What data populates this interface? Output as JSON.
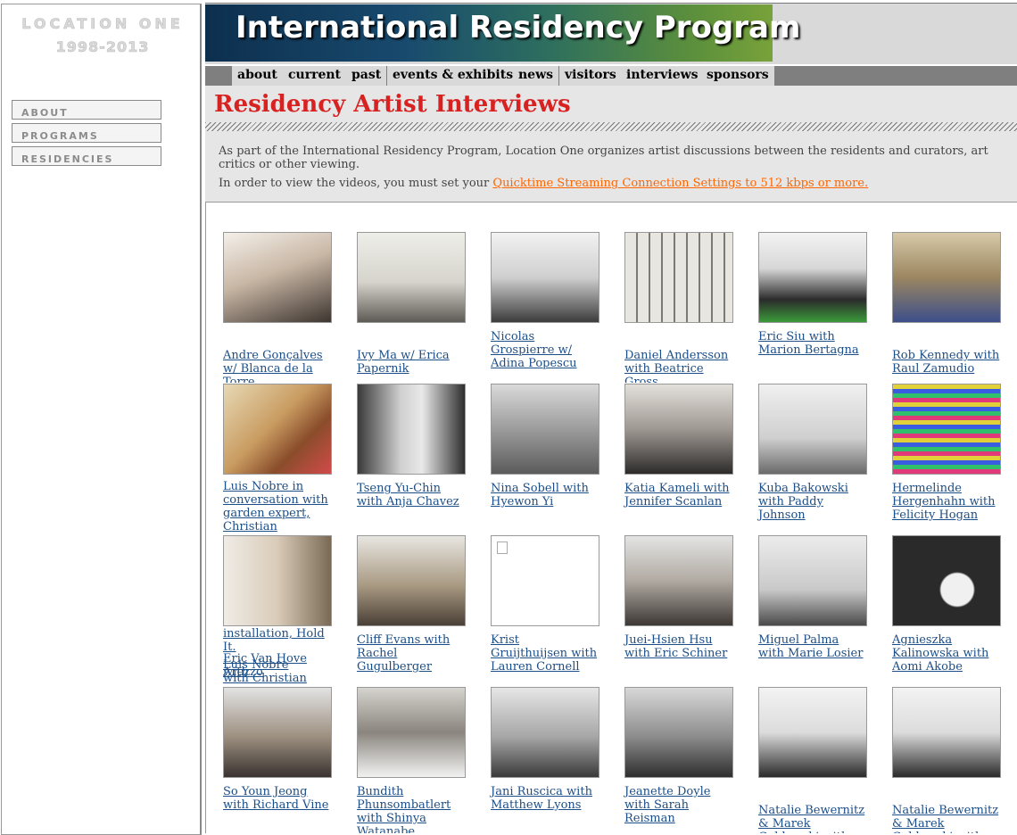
{
  "sidebar": {
    "logo_main": "LOCATION ONE",
    "logo_years": "1998-2013",
    "buttons": [
      "ABOUT",
      "PROGRAMS",
      "RESIDENCIES"
    ]
  },
  "banner": {
    "title": "International Residency Program"
  },
  "nav": [
    "about",
    "current",
    "past",
    "events & exhibits",
    "news",
    "visitors",
    "interviews",
    "sponsors"
  ],
  "page": {
    "title": "Residency Artist Interviews",
    "intro": "As part of the International Residency Program, Location One organizes artist discussions between the residents and curators, art critics or other viewing.",
    "note_prefix": "In order to view the videos, you must set your ",
    "note_link": "Quicktime Streaming Connection Settings to 512 kbps or more."
  },
  "overlap_texts": [
    "installation, Hold It.",
    "Arezzo",
    "Eric Van Hove with",
    "Luis Nobre with Christian"
  ],
  "interviews": [
    {
      "caption": "Andre Gonçalves w/ Blanca de la Torre"
    },
    {
      "caption": "Ivy Ma w/ Erica Papernik"
    },
    {
      "caption": "Nicolas Grospierre w/ Adina Popescu"
    },
    {
      "caption": "Daniel Andersson with Beatrice Gross"
    },
    {
      "caption": "Eric Siu with Marion Bertagna"
    },
    {
      "caption": "Rob Kennedy with Raul Zamudio"
    },
    {
      "caption": "Luis Nobre in conversation with garden expert, Christian"
    },
    {
      "caption": "Tseng Yu-Chin with Anja Chavez"
    },
    {
      "caption": "Nina Sobell with Hyewon Yi"
    },
    {
      "caption": "Katia Kameli with Jennifer Scanlan"
    },
    {
      "caption": "Kuba Bakowski with Paddy Johnson"
    },
    {
      "caption": "Hermelinde Hergenhahn with Felicity Hogan"
    },
    {
      "caption": ""
    },
    {
      "caption": "Cliff Evans with Rachel Gugulberger"
    },
    {
      "caption": "Krist Gruijthuijsen with Lauren Cornell"
    },
    {
      "caption": "Juei-Hsien Hsu with Eric Schiner"
    },
    {
      "caption": "Miguel Palma with Marie Losier"
    },
    {
      "caption": "Agnieszka Kalinowska with Aomi Akobe"
    },
    {
      "caption": "So Youn Jeong with Richard Vine"
    },
    {
      "caption": "Bundith Phunsombatlert with Shinya Watanabe"
    },
    {
      "caption": "Jani Ruscica with Matthew Lyons"
    },
    {
      "caption": "Jeanette Doyle with Sarah Reisman"
    },
    {
      "caption": "Natalie Bewernitz & Marek Goldowski with"
    },
    {
      "caption": "Natalie Bewernitz & Marek Goldowski with"
    }
  ]
}
